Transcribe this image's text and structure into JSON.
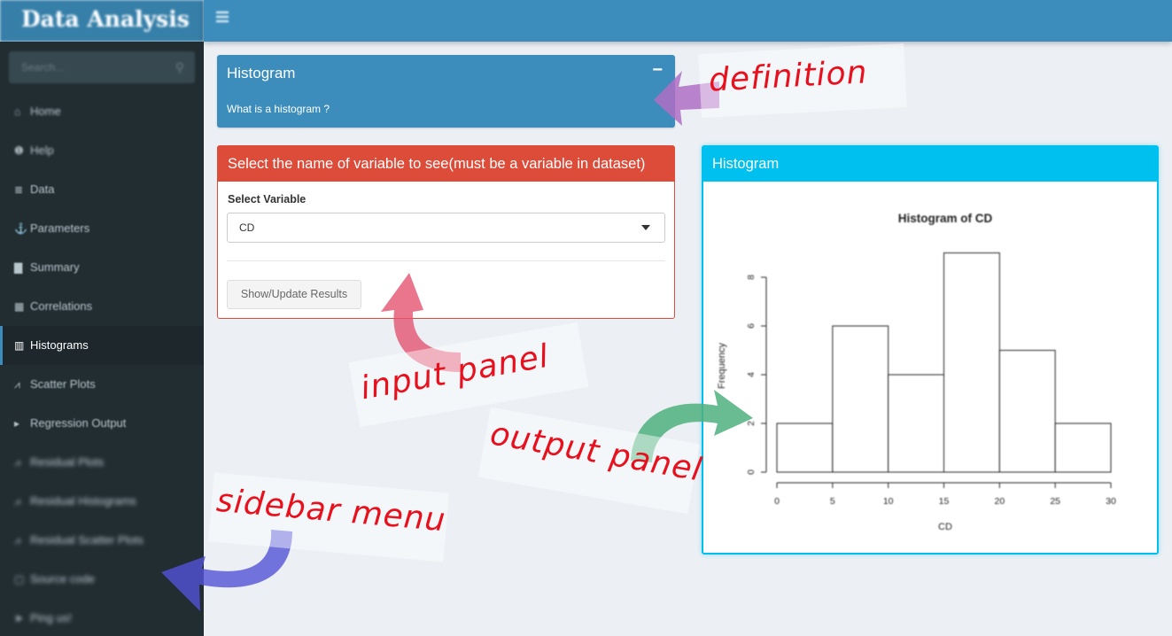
{
  "header": {
    "logo": "Data Analysis"
  },
  "sidebar": {
    "search_placeholder": "Search...",
    "items": [
      {
        "label": "Home",
        "icon": "home-icon",
        "glyph": "⌂"
      },
      {
        "label": "Help",
        "icon": "info-icon",
        "glyph": "❶"
      },
      {
        "label": "Data",
        "icon": "database-icon",
        "glyph": "≣"
      },
      {
        "label": "Parameters",
        "icon": "anchor-icon",
        "glyph": "⚓"
      },
      {
        "label": "Summary",
        "icon": "book-icon",
        "glyph": "▇"
      },
      {
        "label": "Correlations",
        "icon": "table-icon",
        "glyph": "▦"
      },
      {
        "label": "Histograms",
        "icon": "bar-chart-icon",
        "glyph": "▥"
      },
      {
        "label": "Scatter Plots",
        "icon": "line-chart-icon",
        "glyph": "⩘"
      },
      {
        "label": "Regression Output",
        "icon": "arrow-icon",
        "glyph": "▸"
      },
      {
        "label": "Residual Plots",
        "icon": "line-chart-icon",
        "glyph": "⩘"
      },
      {
        "label": "Residual Histograms",
        "icon": "line-chart-icon",
        "glyph": "⩘"
      },
      {
        "label": "Residual Scatter Plots",
        "icon": "line-chart-icon",
        "glyph": "⩘"
      },
      {
        "label": "Source code",
        "icon": "file-icon",
        "glyph": "▢"
      },
      {
        "label": "Ping us!",
        "icon": "send-icon",
        "glyph": "➤"
      }
    ]
  },
  "definition_box": {
    "title": "Histogram",
    "text": "What is a histogram ?"
  },
  "input_box": {
    "title": "Select the name of variable to see(must be a variable in dataset)",
    "select_label": "Select Variable",
    "select_value": "CD",
    "button_label": "Show/Update Results"
  },
  "output_box": {
    "title": "Histogram"
  },
  "chart_data": {
    "type": "bar",
    "title": "Histogram of CD",
    "xlabel": "CD",
    "ylabel": "Frequency",
    "bins": [
      [
        0,
        5
      ],
      [
        5,
        10
      ],
      [
        10,
        15
      ],
      [
        15,
        20
      ],
      [
        20,
        25
      ],
      [
        25,
        30
      ]
    ],
    "values": [
      2,
      6,
      4,
      9,
      5,
      2
    ],
    "xticks": [
      0,
      5,
      10,
      15,
      20,
      25,
      30
    ],
    "yticks": [
      0,
      2,
      4,
      6,
      8
    ],
    "xlim": [
      0,
      30
    ],
    "ylim": [
      0,
      9
    ]
  },
  "annotations": {
    "definition": "definition",
    "input": "input panel",
    "output": "output panel",
    "sidebar": "sidebar menu",
    "colors": {
      "text": "#e8101d",
      "purple_arrow": "#9b59b6",
      "pink_arrow": "#e04a6a",
      "green_arrow": "#4cae7a",
      "blue_arrow": "#4a4ad0"
    }
  }
}
